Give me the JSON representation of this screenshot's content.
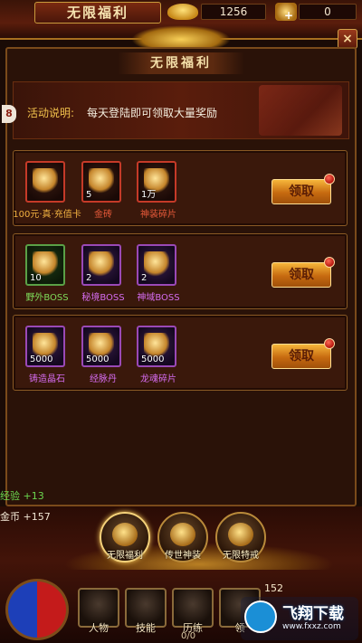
{
  "header": {
    "title": "无限福利",
    "resource1_value": "1256",
    "resource2_value": "0",
    "close_label": "×"
  },
  "panel": {
    "title": "无限福利",
    "banner_badge": "8",
    "activity_label": "活动说明:",
    "activity_text": "每天登陆即可领取大量奖励"
  },
  "rows": [
    {
      "items": [
        {
          "name": "100元·真·充值卡",
          "qty": "",
          "color": "#f0b040",
          "rarity": "red",
          "icon": "recharge-card-icon"
        },
        {
          "name": "金砖",
          "qty": "5",
          "color": "#e85a3a",
          "rarity": "red",
          "icon": "gold-brick-icon"
        },
        {
          "name": "神装碎片",
          "qty": "1万",
          "color": "#e85a3a",
          "rarity": "red",
          "icon": "armor-shard-icon"
        }
      ],
      "claim_label": "领取"
    },
    {
      "items": [
        {
          "name": "野外BOSS",
          "qty": "10",
          "color": "#7fdc5a",
          "rarity": "green",
          "icon": "field-boss-scroll-icon"
        },
        {
          "name": "秘境BOSS",
          "qty": "2",
          "color": "#d56cf0",
          "rarity": "purple",
          "icon": "secret-boss-scroll-icon"
        },
        {
          "name": "神域BOSS",
          "qty": "2",
          "color": "#d56cf0",
          "rarity": "purple",
          "icon": "divine-boss-scroll-icon"
        }
      ],
      "claim_label": "领取"
    },
    {
      "items": [
        {
          "name": "铸造晶石",
          "qty": "5000",
          "color": "#d56cf0",
          "rarity": "purple",
          "icon": "forging-crystal-icon"
        },
        {
          "name": "经脉丹",
          "qty": "5000",
          "color": "#d56cf0",
          "rarity": "purple",
          "icon": "meridian-pill-icon"
        },
        {
          "name": "龙魂碎片",
          "qty": "5000",
          "color": "#d56cf0",
          "rarity": "purple",
          "icon": "dragon-soul-shard-icon"
        }
      ],
      "claim_label": "领取"
    }
  ],
  "log": {
    "exp_line": "经验 +13",
    "gold_line": "金币  +157"
  },
  "tabs": [
    {
      "label": "无限福利",
      "active": true
    },
    {
      "label": "传世神装",
      "active": false
    },
    {
      "label": "无限特戒",
      "active": false
    }
  ],
  "bottom": {
    "functions": [
      "人物",
      "技能",
      "历练",
      "领"
    ],
    "counter": "0/0",
    "level_number": "152",
    "watermark_brand": "飞翔下载",
    "watermark_url": "www.fxxz.com"
  },
  "colors": {
    "accent_gold": "#f2c24c",
    "claim_button": "#f6b63a",
    "frame_red": "#c53a28"
  }
}
